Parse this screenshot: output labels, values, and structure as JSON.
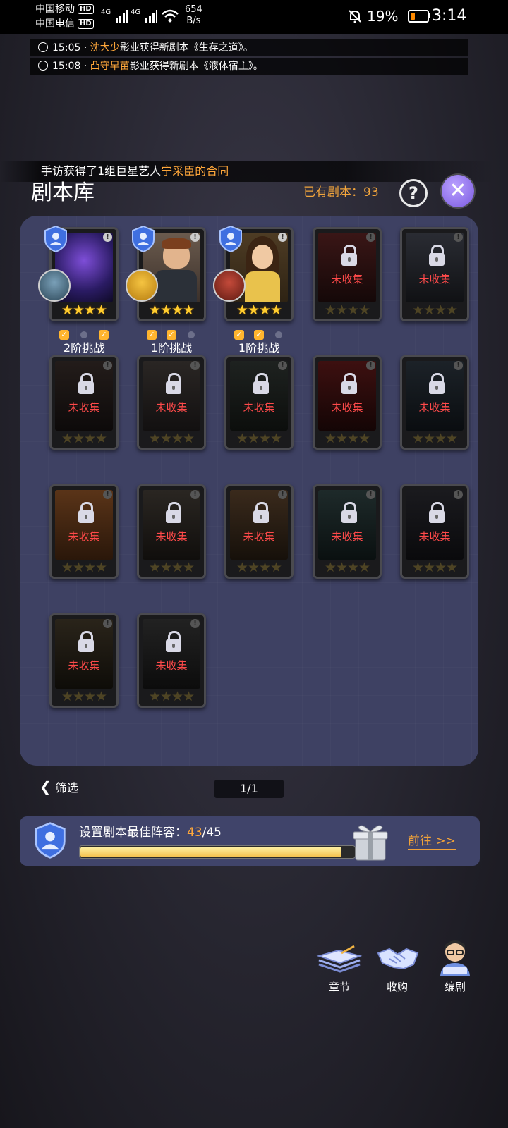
{
  "status_bar": {
    "carrier_1": "中国移动",
    "carrier_2": "中国电信",
    "hd": "HD",
    "network": "4G",
    "speed_value": "654",
    "speed_unit": "B/s",
    "battery": "19%",
    "battery_level": 0.19,
    "time": "3:14"
  },
  "news": [
    {
      "time": "15:05",
      "sep": "·",
      "name": "沈大少",
      "text": "影业获得新剧本《生存之道》。"
    },
    {
      "time": "15:08",
      "sep": "·",
      "name": "凸守早苗",
      "text": "影业获得新剧本《液体宿主》。"
    }
  ],
  "banner": {
    "prefix": "手访获得了1组巨星艺人",
    "highlight": "宁采臣的合同"
  },
  "header": {
    "title": "剧本库",
    "owned": "已有剧本：93",
    "help": "?",
    "close": "✕"
  },
  "cards": {
    "stars": "★★★★",
    "locked_label": "未收集",
    "info": "!",
    "unlocked": [
      {
        "tier": "2阶挑战",
        "checks": [
          true,
          false,
          true
        ]
      },
      {
        "tier": "1阶挑战",
        "checks": [
          true,
          true,
          false
        ]
      },
      {
        "tier": "1阶挑战",
        "checks": [
          true,
          true,
          false
        ]
      }
    ]
  },
  "footer": {
    "filter": "筛选",
    "page": "1/1"
  },
  "lineup": {
    "label": "设置剧本最佳阵容：",
    "current": "43",
    "total": "/45",
    "progress": 0.955,
    "goto": "前往 >>"
  },
  "dock": [
    {
      "label": "章节"
    },
    {
      "label": "收购"
    },
    {
      "label": "编剧"
    }
  ]
}
